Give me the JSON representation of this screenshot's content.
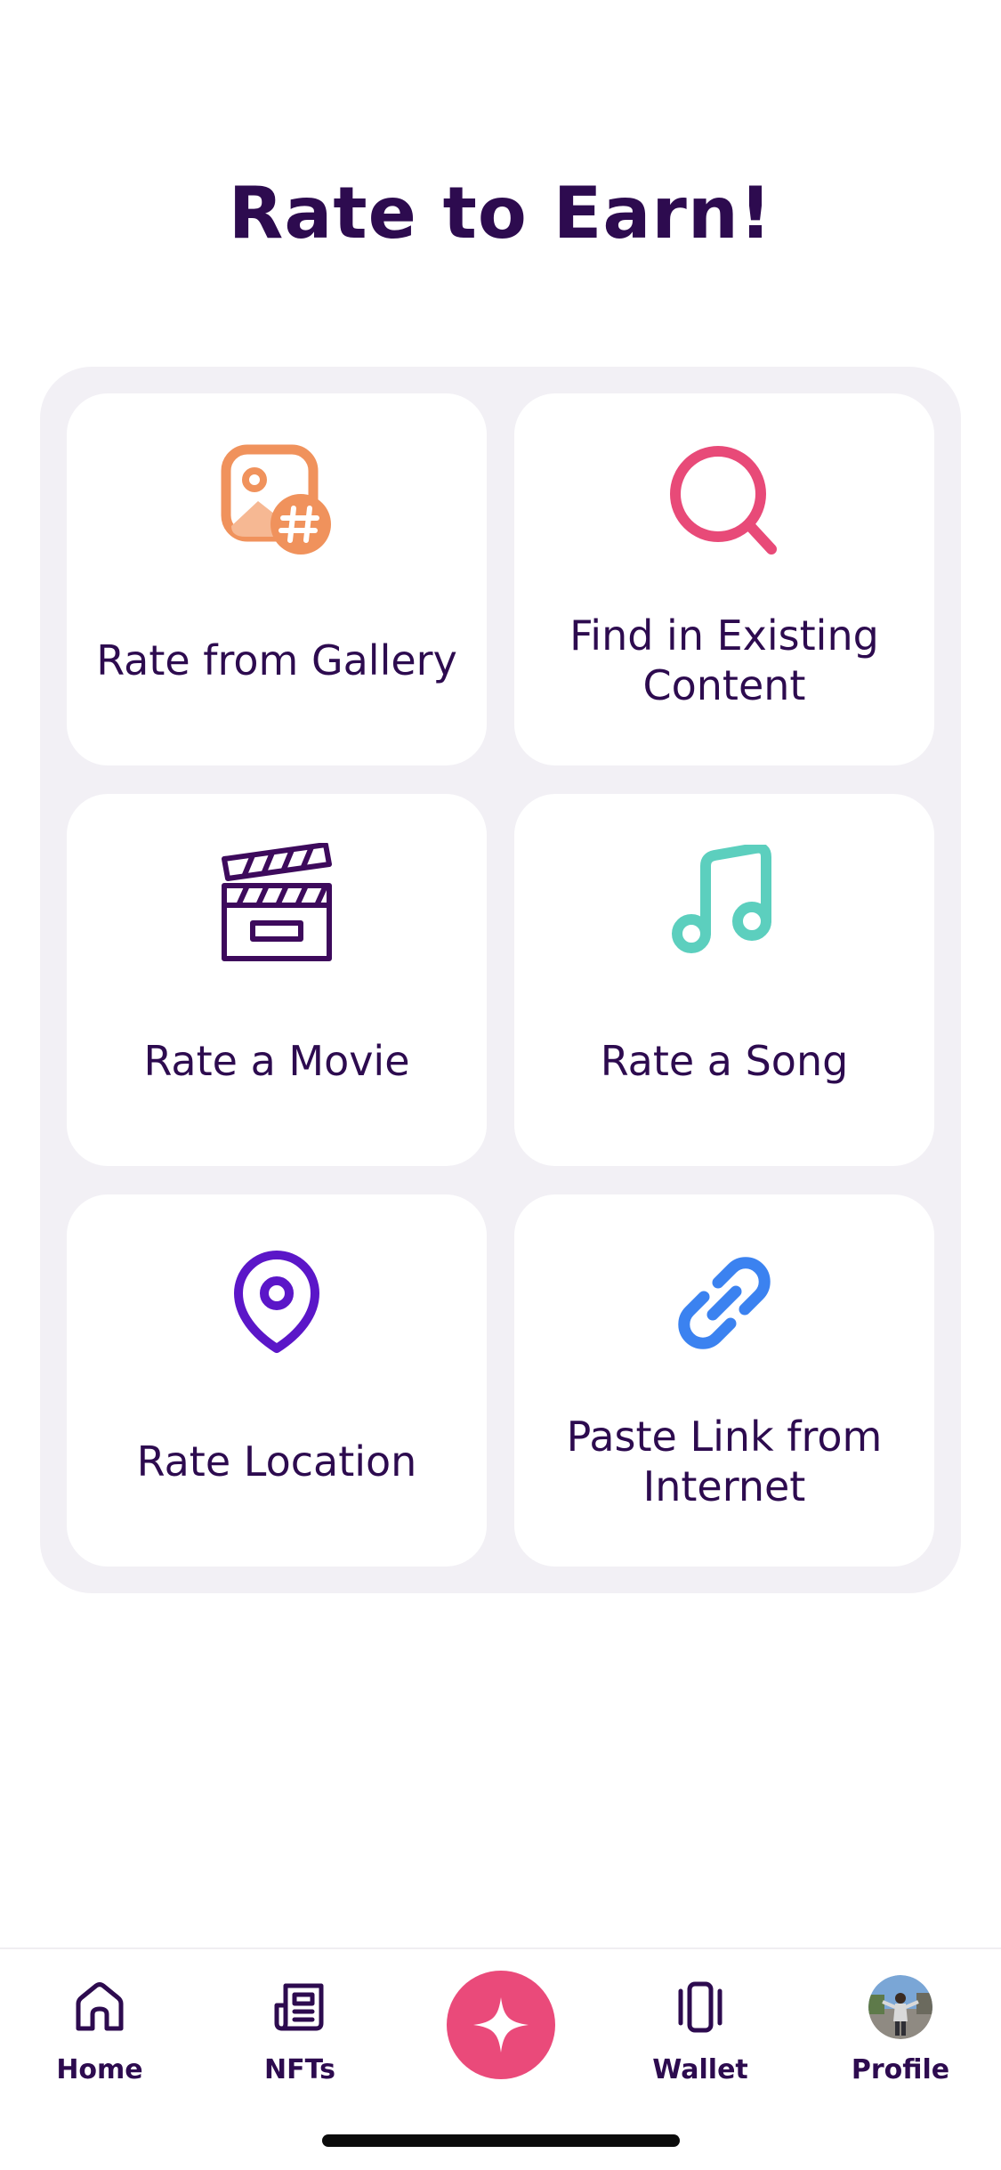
{
  "page": {
    "title": "Rate to Earn!"
  },
  "options": [
    {
      "label": "Rate from Gallery",
      "icon": "gallery-hashtag-icon",
      "color": "#f0925c"
    },
    {
      "label": "Find in Existing Content",
      "icon": "search-icon",
      "color": "#e84a78"
    },
    {
      "label": "Rate a Movie",
      "icon": "clapperboard-icon",
      "color": "#3d0a5c"
    },
    {
      "label": "Rate a Song",
      "icon": "music-note-icon",
      "color": "#5ccfbe"
    },
    {
      "label": "Rate Location",
      "icon": "location-pin-icon",
      "color": "#5b16c8"
    },
    {
      "label": "Paste Link from Internet",
      "icon": "link-icon",
      "color": "#3b82f0"
    }
  ],
  "tabbar": {
    "home": {
      "label": "Home",
      "icon": "home-icon"
    },
    "nfts": {
      "label": "NFTs",
      "icon": "newspaper-icon"
    },
    "center": {
      "icon": "sparkle-icon",
      "color": "#ea4a7a"
    },
    "wallet": {
      "label": "Wallet",
      "icon": "cards-icon"
    },
    "profile": {
      "label": "Profile",
      "icon": "avatar"
    }
  },
  "colors": {
    "text": "#2d0b4f",
    "panel": "#f2f0f5",
    "accent": "#ea4a7a"
  }
}
